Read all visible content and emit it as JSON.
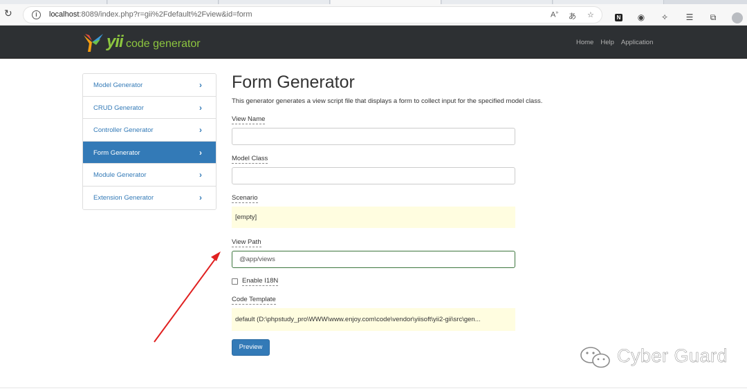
{
  "browser": {
    "url_host": "localhost",
    "url_rest": ":8089/index.php?r=gii%2Fdefault%2Fview&id=form"
  },
  "navbar": {
    "brand_yii": "yii",
    "brand_text": "code generator",
    "links": [
      "Home",
      "Help",
      "Application"
    ]
  },
  "sidebar": {
    "items": [
      {
        "label": "Model Generator",
        "chevron": "›"
      },
      {
        "label": "CRUD Generator",
        "chevron": "›"
      },
      {
        "label": "Controller Generator",
        "chevron": "›"
      },
      {
        "label": "Form Generator",
        "chevron": "›"
      },
      {
        "label": "Module Generator",
        "chevron": "›"
      },
      {
        "label": "Extension Generator",
        "chevron": "›"
      }
    ],
    "active_index": 3
  },
  "main": {
    "title": "Form Generator",
    "description": "This generator generates a view script file that displays a form to collect input for the specified model class.",
    "view_name_label": "View Name",
    "view_name_value": "",
    "model_class_label": "Model Class",
    "model_class_value": "",
    "scenario_label": "Scenario",
    "scenario_value": "[empty]",
    "view_path_label": "View Path",
    "view_path_value": "@app/views",
    "enable_i18n_label": "Enable I18N",
    "code_template_label": "Code Template",
    "code_template_value": "default (D:\\phpstudy_pro\\WWW\\www.enjoy.com\\code\\vendor\\yiisoft\\yii2-gii\\src\\gen...",
    "preview_button": "Preview"
  },
  "watermark": {
    "text": "Cyber Guard"
  },
  "colors": {
    "navbar": "#2d3033",
    "brand": "#8dc63f",
    "link": "#337ab7",
    "sticky": "#fffde0",
    "arrow": "#e02020"
  }
}
